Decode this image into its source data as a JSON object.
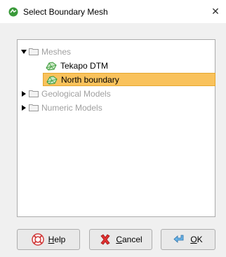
{
  "window": {
    "title": "Select Boundary Mesh",
    "close_icon": "close-icon"
  },
  "tree": {
    "items": [
      {
        "label": "Meshes",
        "level": 0,
        "expanded": true,
        "kind": "folder"
      },
      {
        "label": "Tekapo DTM",
        "level": 1,
        "kind": "mesh"
      },
      {
        "label": "North boundary",
        "level": 1,
        "kind": "mesh",
        "selected": true
      },
      {
        "label": "Geological Models",
        "level": 0,
        "expanded": false,
        "kind": "folder"
      },
      {
        "label": "Numeric Models",
        "level": 0,
        "expanded": false,
        "kind": "folder"
      }
    ]
  },
  "buttons": {
    "help": {
      "pre": "",
      "mnemonic": "H",
      "post": "elp"
    },
    "cancel": {
      "pre": "",
      "mnemonic": "C",
      "post": "ancel"
    },
    "ok": {
      "pre": "",
      "mnemonic": "O",
      "post": "K"
    }
  },
  "colors": {
    "selection": "#f9c25c",
    "folder_outline": "#9a9a9a",
    "mesh_green": "#3a9a3a"
  }
}
